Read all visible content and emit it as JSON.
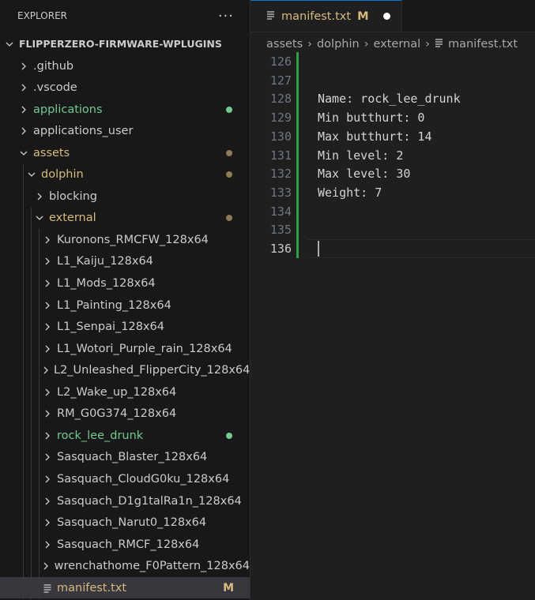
{
  "explorer": {
    "title": "EXPLORER",
    "more": "···",
    "root": "FLIPPERZERO-FIRMWARE-WPLUGINS",
    "items": [
      {
        "label": ".github",
        "depth": 1,
        "type": "folder",
        "open": false,
        "color": "#cccccc"
      },
      {
        "label": ".vscode",
        "depth": 1,
        "type": "folder",
        "open": false,
        "color": "#cccccc"
      },
      {
        "label": "applications",
        "depth": 1,
        "type": "folder",
        "open": false,
        "color": "#73c991",
        "dot": "#73c991"
      },
      {
        "label": "applications_user",
        "depth": 1,
        "type": "folder",
        "open": false,
        "color": "#cccccc"
      },
      {
        "label": "assets",
        "depth": 1,
        "type": "folder",
        "open": true,
        "color": "#d7ba7d",
        "dot": "#8d7a56"
      },
      {
        "label": "dolphin",
        "depth": 2,
        "type": "folder",
        "open": true,
        "color": "#d7ba7d",
        "dot": "#8d7a56"
      },
      {
        "label": "blocking",
        "depth": 3,
        "type": "folder",
        "open": false,
        "color": "#cccccc"
      },
      {
        "label": "external",
        "depth": 3,
        "type": "folder",
        "open": true,
        "color": "#d7ba7d",
        "dot": "#8d7a56"
      },
      {
        "label": "Kuronons_RMCFW_128x64",
        "depth": 4,
        "type": "folder",
        "open": false,
        "color": "#cccccc"
      },
      {
        "label": "L1_Kaiju_128x64",
        "depth": 4,
        "type": "folder",
        "open": false,
        "color": "#cccccc"
      },
      {
        "label": "L1_Mods_128x64",
        "depth": 4,
        "type": "folder",
        "open": false,
        "color": "#cccccc"
      },
      {
        "label": "L1_Painting_128x64",
        "depth": 4,
        "type": "folder",
        "open": false,
        "color": "#cccccc"
      },
      {
        "label": "L1_Senpai_128x64",
        "depth": 4,
        "type": "folder",
        "open": false,
        "color": "#cccccc"
      },
      {
        "label": "L1_Wotori_Purple_rain_128x64",
        "depth": 4,
        "type": "folder",
        "open": false,
        "color": "#cccccc"
      },
      {
        "label": "L2_Unleashed_FlipperCity_128x64",
        "depth": 4,
        "type": "folder",
        "open": false,
        "color": "#cccccc"
      },
      {
        "label": "L2_Wake_up_128x64",
        "depth": 4,
        "type": "folder",
        "open": false,
        "color": "#cccccc"
      },
      {
        "label": "RM_G0G374_128x64",
        "depth": 4,
        "type": "folder",
        "open": false,
        "color": "#cccccc"
      },
      {
        "label": "rock_lee_drunk",
        "depth": 4,
        "type": "folder",
        "open": false,
        "color": "#73c991",
        "dot": "#73c991"
      },
      {
        "label": "Sasquach_Blaster_128x64",
        "depth": 4,
        "type": "folder",
        "open": false,
        "color": "#cccccc"
      },
      {
        "label": "Sasquach_CloudG0ku_128x64",
        "depth": 4,
        "type": "folder",
        "open": false,
        "color": "#cccccc"
      },
      {
        "label": "Sasquach_D1g1talRa1n_128x64",
        "depth": 4,
        "type": "folder",
        "open": false,
        "color": "#cccccc"
      },
      {
        "label": "Sasquach_Narut0_128x64",
        "depth": 4,
        "type": "folder",
        "open": false,
        "color": "#cccccc"
      },
      {
        "label": "Sasquach_RMCF_128x64",
        "depth": 4,
        "type": "folder",
        "open": false,
        "color": "#cccccc"
      },
      {
        "label": "wrenchathome_F0Pattern_128x64",
        "depth": 4,
        "type": "folder",
        "open": false,
        "color": "#cccccc"
      },
      {
        "label": "manifest.txt",
        "depth": 4,
        "type": "file",
        "color": "#d7ba7d",
        "badge": "M",
        "selected": true
      }
    ]
  },
  "tab": {
    "label": "manifest.txt",
    "status": "M"
  },
  "breadcrumb": [
    "assets",
    "dolphin",
    "external",
    "manifest.txt"
  ],
  "code": [
    {
      "n": "126",
      "text": ""
    },
    {
      "n": "127",
      "text": ""
    },
    {
      "n": "128",
      "text": "Name: rock_lee_drunk"
    },
    {
      "n": "129",
      "text": "Min butthurt: 0"
    },
    {
      "n": "130",
      "text": "Max butthurt: 14"
    },
    {
      "n": "131",
      "text": "Min level: 2"
    },
    {
      "n": "132",
      "text": "Max level: 30"
    },
    {
      "n": "133",
      "text": "Weight: 7"
    },
    {
      "n": "134",
      "text": ""
    },
    {
      "n": "135",
      "text": ""
    },
    {
      "n": "136",
      "text": "",
      "current": true
    }
  ]
}
